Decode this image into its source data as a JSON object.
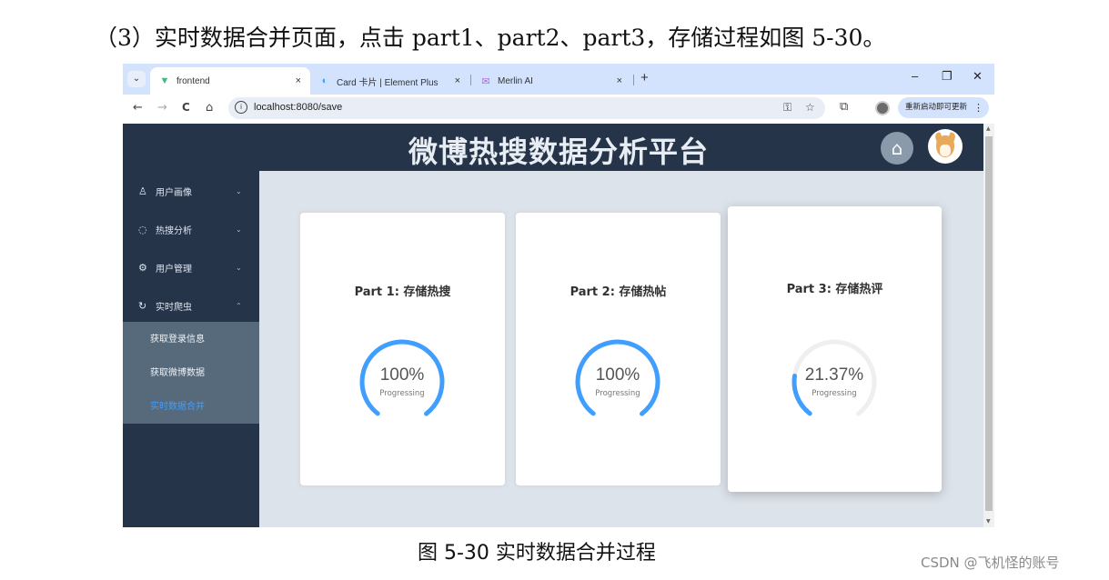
{
  "document": {
    "heading": "（3）实时数据合并页面，点击 part1、part2、part3，存储过程如图 5-30。",
    "caption": "图 5-30 实时数据合并过程",
    "watermark": "CSDN @飞机怪的账号"
  },
  "browser": {
    "tabs": [
      {
        "title": "frontend",
        "icon": "vue-icon",
        "active": true
      },
      {
        "title": "Card 卡片 | Element Plus",
        "icon": "element-plus-icon",
        "active": false
      },
      {
        "title": "Merlin AI",
        "icon": "merlin-icon",
        "active": false
      }
    ],
    "tab_close_glyph": "×",
    "new_tab_glyph": "+",
    "window_controls": {
      "minimize": "–",
      "restore": "❐",
      "close": "✕"
    },
    "nav": {
      "back": "←",
      "forward": "→",
      "reload": "C",
      "home": "⌂"
    },
    "url": "localhost:8080/save",
    "update_button": "重新启动即可更新",
    "update_more": "⋮"
  },
  "app": {
    "title": "微博热搜数据分析平台",
    "sidebar": {
      "items": [
        {
          "label": "用户画像",
          "icon": "user-icon",
          "expanded": false
        },
        {
          "label": "热搜分析",
          "icon": "chat-icon",
          "expanded": false
        },
        {
          "label": "用户管理",
          "icon": "gear-icon",
          "expanded": false
        },
        {
          "label": "实时爬虫",
          "icon": "refresh-icon",
          "expanded": true
        }
      ],
      "submenu": [
        {
          "label": "获取登录信息",
          "active": false
        },
        {
          "label": "获取微博数据",
          "active": false
        },
        {
          "label": "实时数据合并",
          "active": true
        }
      ]
    },
    "cards": [
      {
        "title": "Part 1: 存储热搜",
        "progress": 100,
        "progress_text": "100%",
        "status": "Progressing"
      },
      {
        "title": "Part 2: 存储热帖",
        "progress": 100,
        "progress_text": "100%",
        "status": "Progressing"
      },
      {
        "title": "Part 3: 存储热评",
        "progress": 21.37,
        "progress_text": "21.37%",
        "status": "Progressing"
      }
    ],
    "colors": {
      "header": "#263449",
      "progress": "#409eff",
      "active_submenu": "#409eff"
    }
  }
}
